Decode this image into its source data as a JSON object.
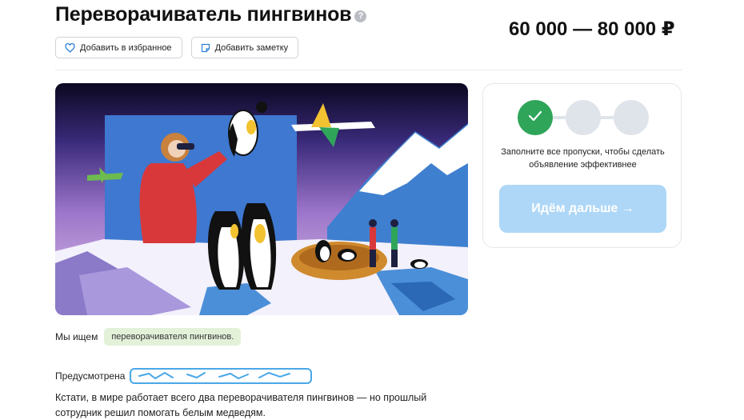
{
  "header": {
    "title": "Переворачиватель пингвинов",
    "help_icon": "question-circle-icon",
    "price": "60 000 — 80 000 ₽"
  },
  "actions": {
    "favorite_label": "Добавить в избранное",
    "favorite_icon": "heart-icon",
    "note_label": "Добавить заметку",
    "note_icon": "sticky-note-icon"
  },
  "illustration": {
    "icon": "penguin-illustration"
  },
  "progress_card": {
    "steps_total": 3,
    "steps_done": 1,
    "hint": "Заполните все пропуски, чтобы сделать объявление эффективнее",
    "next_label": "Идём дальше →",
    "accent": "#2fa55a",
    "button_color": "#aed7f7"
  },
  "details": {
    "looking_for_label": "Мы ищем",
    "looking_for_tag": "переворачивателя пингвинов.",
    "provided_label": "Предусмотрена",
    "description": "Кстати, в мире работает всего два переворачивателя пингвинов — но прошлый сотрудник решил помогать белым медведям."
  }
}
